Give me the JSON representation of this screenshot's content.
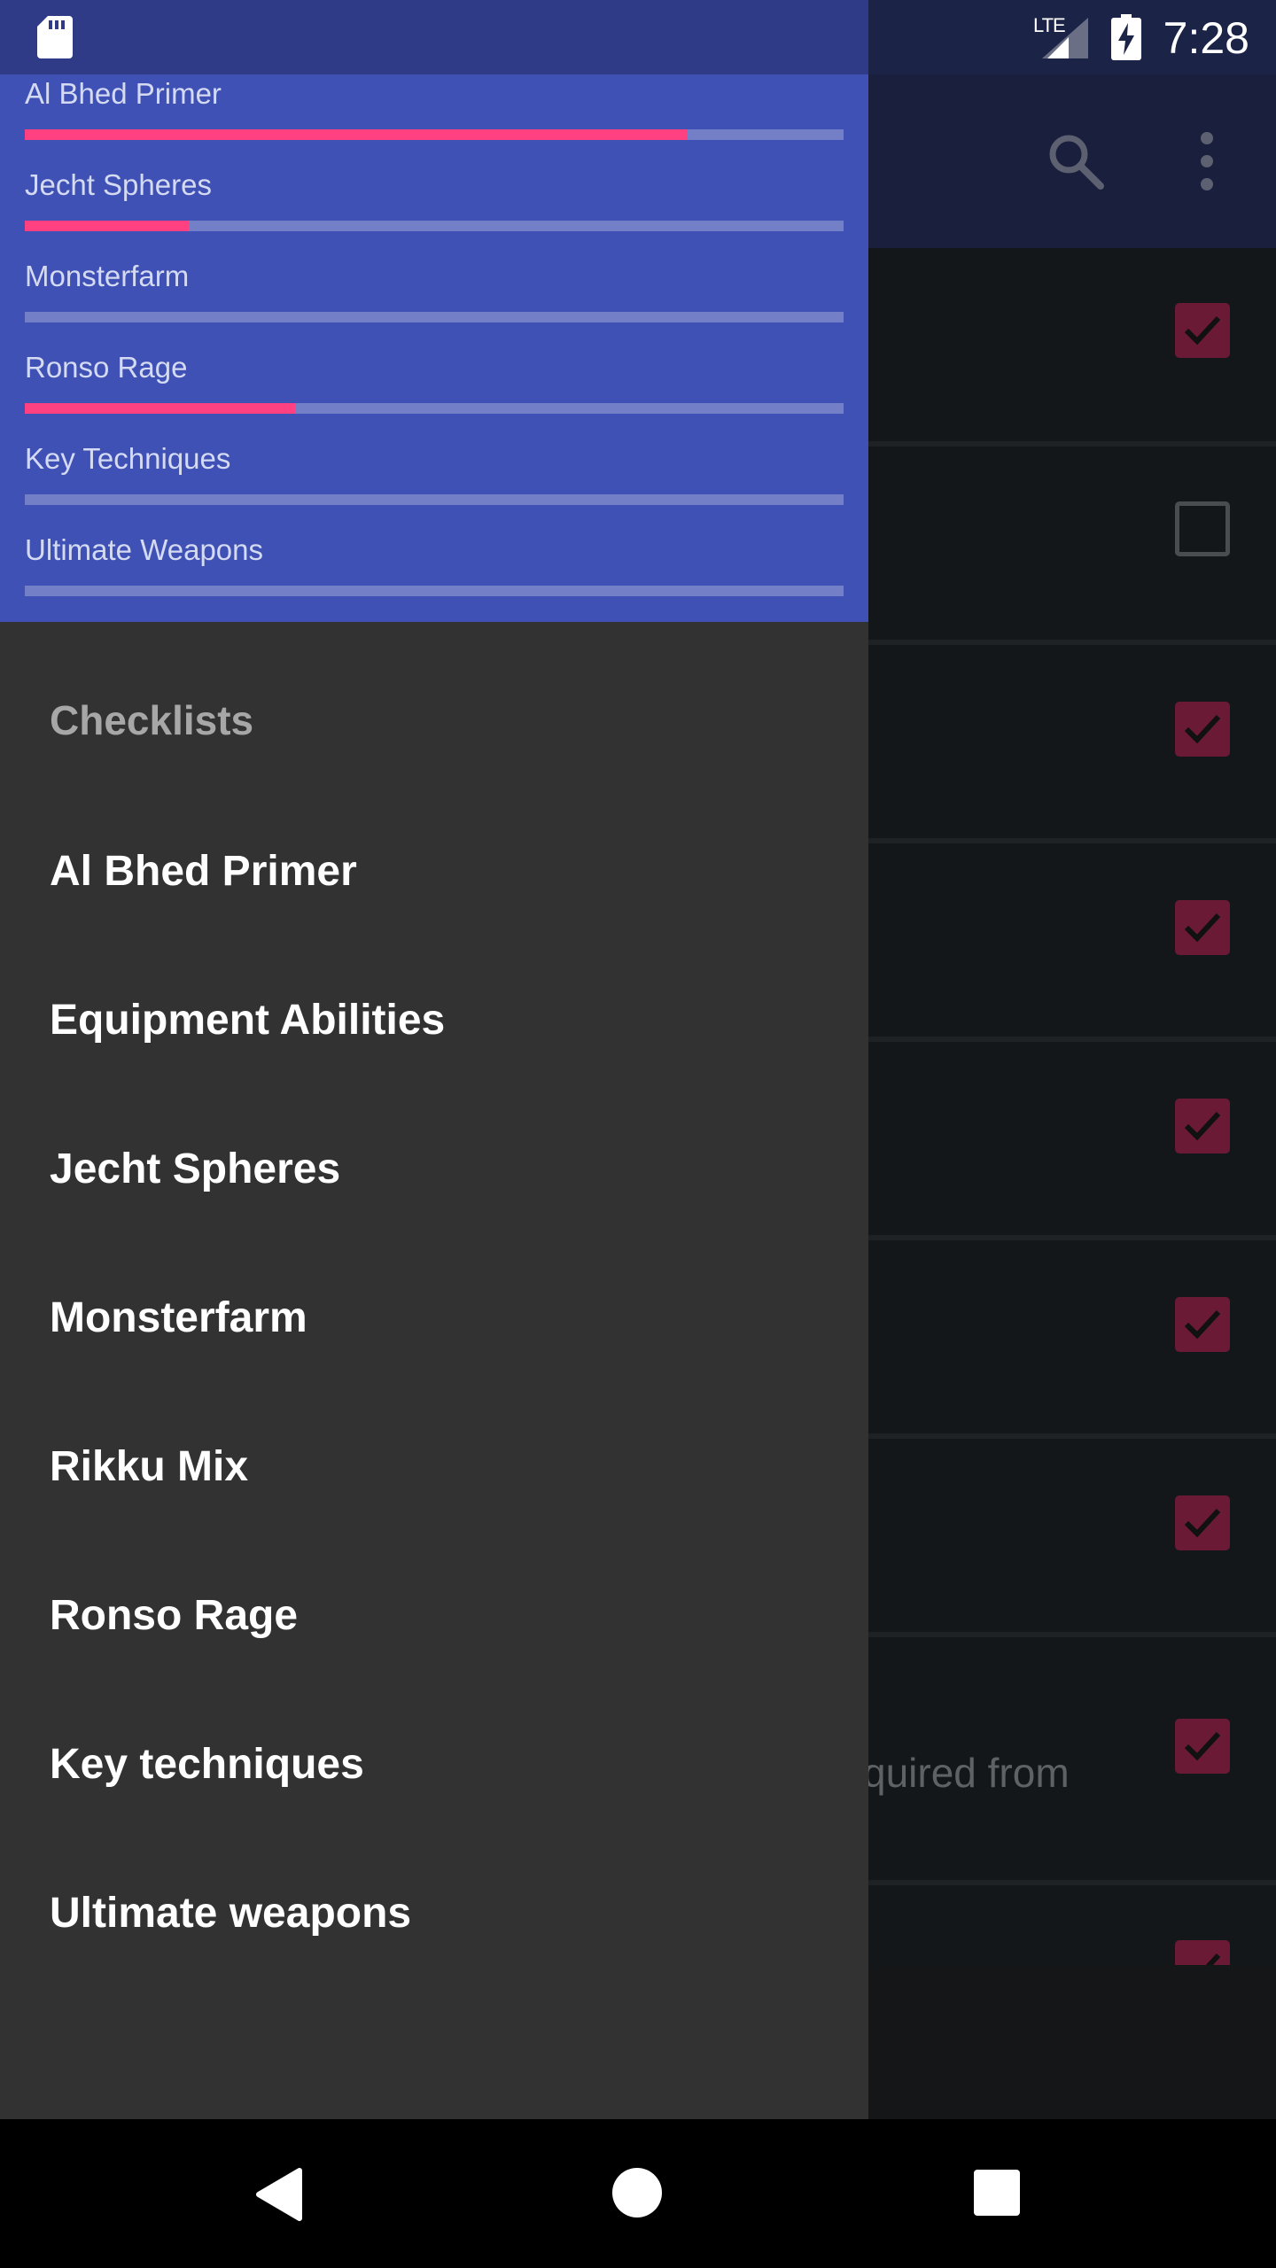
{
  "status_bar": {
    "network": "LTE",
    "time": "7:28",
    "icons": [
      "sd-card-icon",
      "signal-icon",
      "battery-charging-icon"
    ]
  },
  "app_bar": {
    "actions": [
      "search-icon",
      "more-vert-icon"
    ]
  },
  "background_list": {
    "partial_text": "quired from",
    "checkbox_states": [
      true,
      false,
      true,
      true,
      true,
      true,
      true,
      true,
      true
    ]
  },
  "drawer": {
    "progress": [
      {
        "label": "Al Bhed Primer",
        "fraction": 0.81
      },
      {
        "label": "Jecht Spheres",
        "fraction": 0.2
      },
      {
        "label": "Monsterfarm",
        "fraction": 0
      },
      {
        "label": "Ronso Rage",
        "fraction": 0.33
      },
      {
        "label": "Key Techniques",
        "fraction": 0
      },
      {
        "label": "Ultimate Weapons",
        "fraction": 0
      }
    ],
    "section_title": "Checklists",
    "items": [
      "Al Bhed Primer",
      "Equipment Abilities",
      "Jecht Spheres",
      "Monsterfarm",
      "Rikku Mix",
      "Ronso Rage",
      "Key techniques",
      "Ultimate weapons"
    ]
  },
  "nav_bar": {
    "buttons": [
      "back-icon",
      "home-icon",
      "recents-icon"
    ]
  },
  "colors": {
    "primary": "#3f51b5",
    "accent": "#ff4081",
    "drawer_background": "#323232",
    "checkbox": "#6b1a36"
  }
}
